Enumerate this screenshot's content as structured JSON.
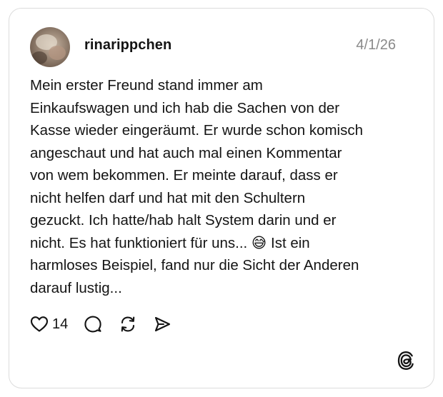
{
  "post": {
    "username": "rinarippchen",
    "date": "4/1/26",
    "text": "Mein erster Freund stand immer am\nEinkaufswagen und ich hab die Sachen von der\nKasse wieder eingeräumt. Er wurde schon komisch\nangeschaut und hat auch mal einen Kommentar\nvon wem bekommen. Er meinte darauf, dass er\nnicht helfen darf und hat mit den Schultern\ngezuckt. Ich hatte/hab halt System darin und er\nnicht. Es hat funktioniert für uns... 😅 Ist ein\nharmloses Beispiel, fand nur die Sicht der Anderen\ndarauf lustig..."
  },
  "actions": {
    "likes": "14",
    "like_icon": "heart-icon",
    "reply_icon": "comment-icon",
    "repost_icon": "repost-icon",
    "share_icon": "send-icon"
  },
  "brand": {
    "logo_icon": "threads-logo-icon"
  }
}
